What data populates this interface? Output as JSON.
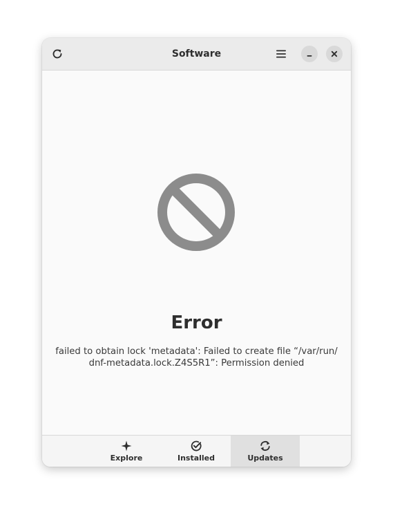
{
  "window": {
    "title": "Software",
    "icons": {
      "refresh": "refresh-icon",
      "menu": "hamburger-menu-icon",
      "minimize": "minimize-icon",
      "close": "close-icon"
    }
  },
  "error": {
    "icon": "prohibited-icon",
    "title": "Error",
    "message": "failed to obtain lock 'metadata': Failed to create file “/var/run/dnf-metadata.lock.Z4S5R1”: Permission denied",
    "message_line1": "failed to obtain lock 'metadata': Failed to create file “/var/run/",
    "message_line2": "dnf-metadata.lock.Z4S5R1”: Permission denied",
    "icon_color": "#8c8c8c"
  },
  "tabs": [
    {
      "label": "Explore",
      "icon": "sparkle-icon",
      "active": false
    },
    {
      "label": "Installed",
      "icon": "check-circle-icon",
      "active": false
    },
    {
      "label": "Updates",
      "icon": "sync-icon",
      "active": true
    }
  ]
}
